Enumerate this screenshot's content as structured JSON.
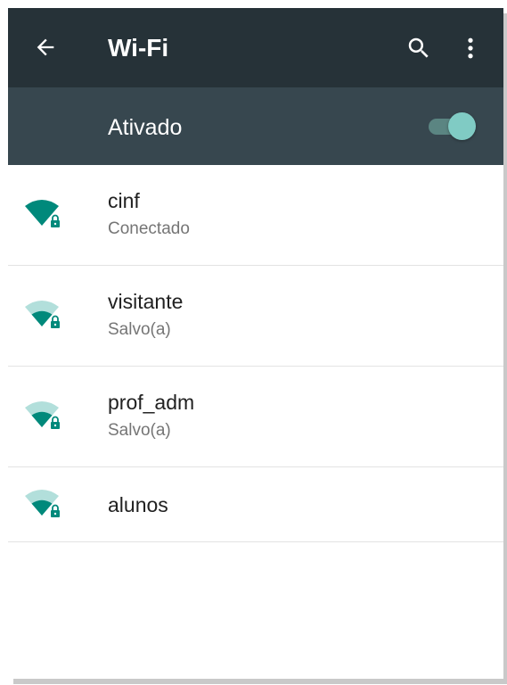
{
  "header": {
    "title": "Wi-Fi",
    "back_icon": "arrow-back-icon",
    "search_icon": "search-icon",
    "more_icon": "more-vert-icon"
  },
  "master_switch": {
    "label": "Ativado",
    "on": true
  },
  "networks": [
    {
      "name": "cinf",
      "status": "Conectado",
      "signal_level": 4,
      "secured": true
    },
    {
      "name": "visitante",
      "status": "Salvo(a)",
      "signal_level": 2,
      "secured": true
    },
    {
      "name": "prof_adm",
      "status": "Salvo(a)",
      "signal_level": 2,
      "secured": true
    },
    {
      "name": "alunos",
      "status": "",
      "signal_level": 2,
      "secured": true
    }
  ],
  "colors": {
    "appbar": "#263238",
    "switchbar": "#37474f",
    "accent": "#009688",
    "toggle_thumb": "#80cbc4",
    "signal_full": "#00897b",
    "signal_empty": "#b2dfdb"
  }
}
